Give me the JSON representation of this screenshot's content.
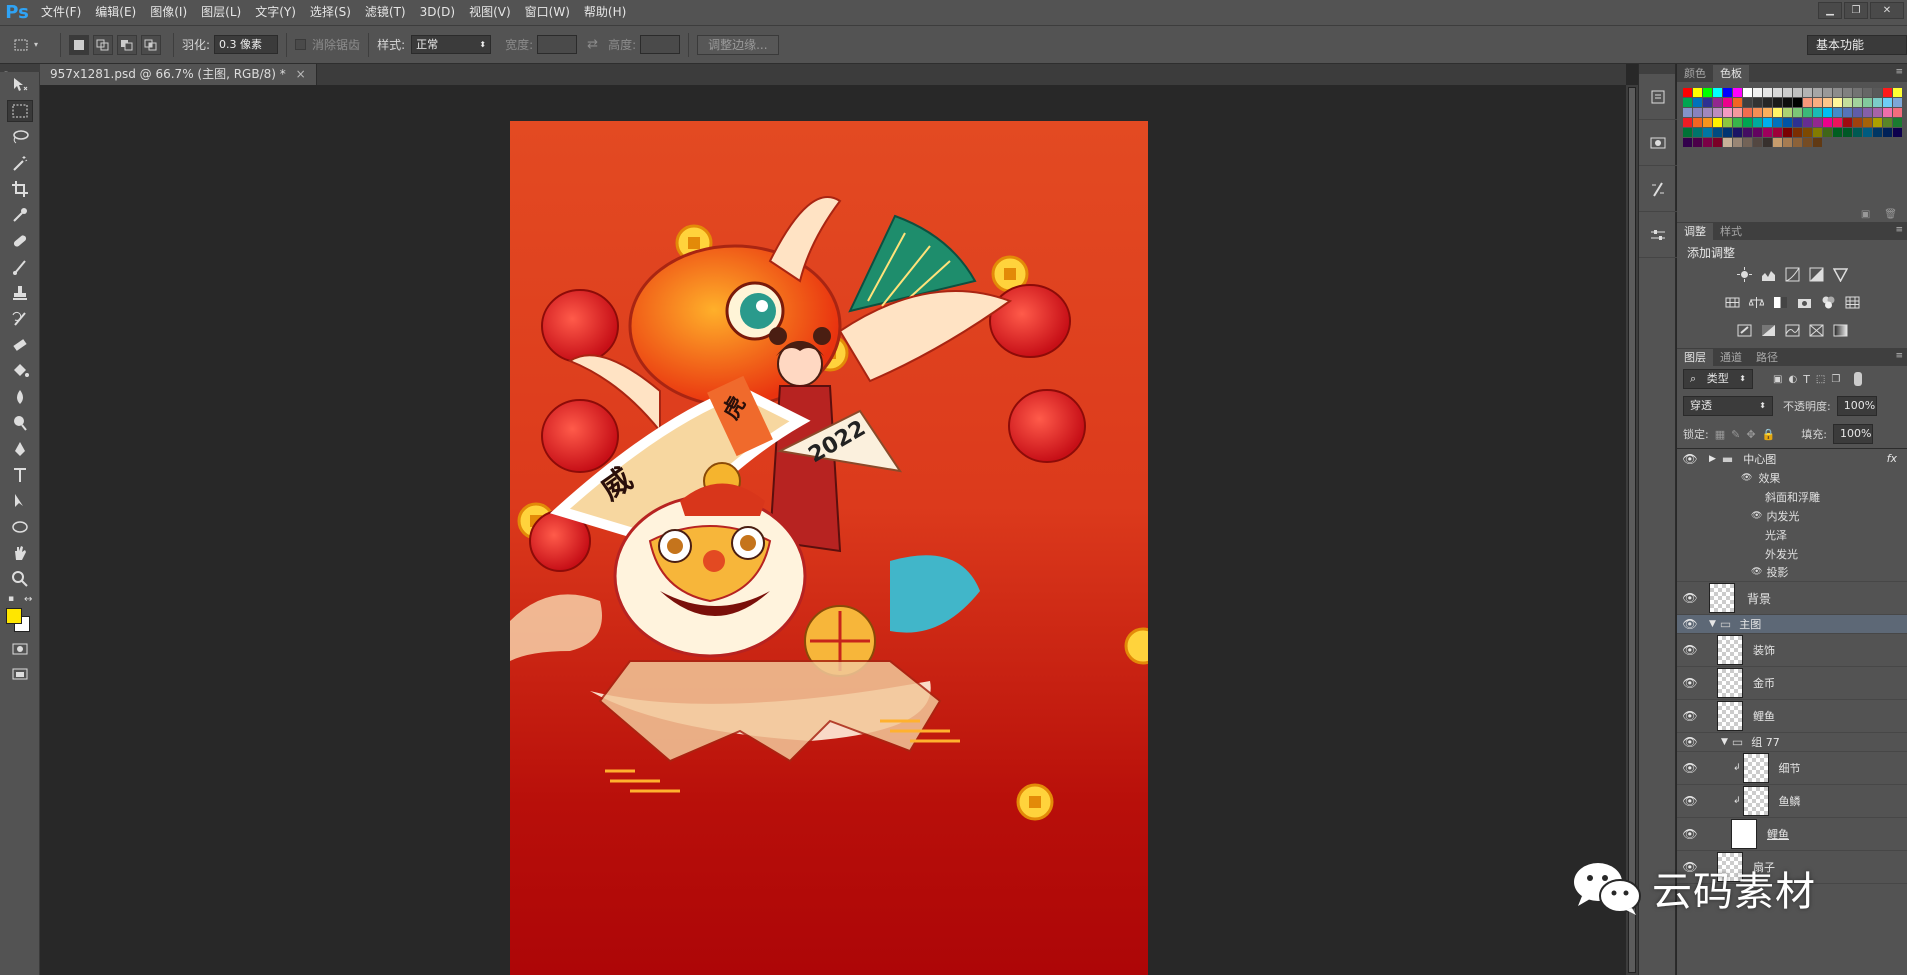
{
  "app": {
    "logo": "Ps"
  },
  "menu": [
    "文件(F)",
    "编辑(E)",
    "图像(I)",
    "图层(L)",
    "文字(Y)",
    "选择(S)",
    "滤镜(T)",
    "3D(D)",
    "视图(V)",
    "窗口(W)",
    "帮助(H)"
  ],
  "window_controls": {
    "minimize": "▁",
    "restore": "❐",
    "close": "✕"
  },
  "options": {
    "feather_label": "羽化:",
    "feather_value": "0.3 像素",
    "antialias_label": "消除锯齿",
    "style_label": "样式:",
    "style_value": "正常",
    "width_label": "宽度:",
    "height_label": "高度:",
    "refine_edge_label": "调整边缘...",
    "workspace": "基本功能"
  },
  "document_tab": {
    "title": "957x1281.psd @ 66.7% (主图, RGB/8) *",
    "close": "×"
  },
  "artwork": {
    "fan_text": "2022",
    "scroll_text_left": "威",
    "scroll_text_right": "虎"
  },
  "swatches_panel": {
    "tabs": [
      "颜色",
      "色板"
    ],
    "active": "色板"
  },
  "swatch_colors": [
    "#ff0000",
    "#ffff00",
    "#00ff00",
    "#00ffff",
    "#0000ff",
    "#ff00ff",
    "#ffffff",
    "#f2f2f2",
    "#e6e6e6",
    "#d9d9d9",
    "#cccccc",
    "#bfbfbf",
    "#b3b3b3",
    "#a6a6a6",
    "#999999",
    "#8c8c8c",
    "#808080",
    "#737373",
    "#666666",
    "#595959",
    "#ff1a1a",
    "#ffff33",
    "#00a651",
    "#0072bc",
    "#2e3192",
    "#92278f",
    "#ec008c",
    "#f26522",
    "#404040",
    "#333333",
    "#262626",
    "#1a1a1a",
    "#0d0d0d",
    "#000000",
    "#f7977a",
    "#f9ad81",
    "#fdc68a",
    "#fff79a",
    "#c4df9b",
    "#a2d39c",
    "#82ca9d",
    "#7bcdc8",
    "#6ecff6",
    "#7ea7d8",
    "#8493ca",
    "#8882be",
    "#a187be",
    "#bc8dbf",
    "#f49ac2",
    "#f6989d",
    "#f26c4f",
    "#f68e55",
    "#fbaf5c",
    "#fff467",
    "#acd372",
    "#7cc576",
    "#3bb878",
    "#1abbb4",
    "#00bff3",
    "#438cca",
    "#5574b9",
    "#605ca8",
    "#855fa8",
    "#a763a8",
    "#f06eaa",
    "#f26d7d",
    "#ed1c24",
    "#f26522",
    "#f7941d",
    "#fff200",
    "#8dc73f",
    "#39b54a",
    "#00a651",
    "#00a99d",
    "#00aeef",
    "#0072bc",
    "#0054a6",
    "#2e3192",
    "#662d91",
    "#92278f",
    "#ec008c",
    "#ed145b",
    "#9e0b0f",
    "#a0410d",
    "#a36209",
    "#aba000",
    "#598527",
    "#1a7b30",
    "#007236",
    "#00746b",
    "#0076a3",
    "#004b80",
    "#003471",
    "#1b1464",
    "#440e62",
    "#630460",
    "#9e005d",
    "#9e0039",
    "#790000",
    "#7b2e00",
    "#7d4900",
    "#827b00",
    "#406618",
    "#005e20",
    "#005826",
    "#005952",
    "#005b7f",
    "#003663",
    "#002157",
    "#0d004c",
    "#32004b",
    "#4b0049",
    "#7b0046",
    "#7a0026",
    "#c7b299",
    "#998675",
    "#736357",
    "#534741",
    "#37302d",
    "#c69c6d",
    "#a67c52",
    "#8c6239",
    "#754c24",
    "#603913"
  ],
  "swatch_footer": {
    "new": "▣",
    "delete": "🗑"
  },
  "adjust_panel": {
    "tabs": [
      "调整",
      "样式"
    ],
    "active": "调整",
    "title": "添加调整"
  },
  "layers_panel": {
    "tabs": [
      "图层",
      "通道",
      "路径"
    ],
    "active": "图层",
    "filter_kind": "类型",
    "blend_mode": "穿透",
    "opacity_label": "不透明度:",
    "opacity_value": "100%",
    "lock_label": "锁定:",
    "fill_label": "填充:",
    "fill_value": "100%",
    "center_group": "中心图",
    "fx": "fx",
    "effects_label": "效果",
    "effects": [
      "斜面和浮雕",
      "内发光",
      "光泽",
      "外发光",
      "投影"
    ],
    "layers": [
      "背景",
      "主图",
      "装饰",
      "金币",
      "鲤鱼",
      "组 77",
      "细节",
      "鱼鳞",
      "鲤鱼",
      "扇子"
    ]
  },
  "watermark": "云码素材"
}
